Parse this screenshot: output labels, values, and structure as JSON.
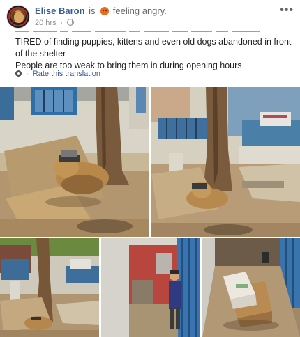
{
  "post": {
    "author": "Elise Baron",
    "is": "is",
    "feeling": "feeling angry.",
    "timestamp": "20 hrs",
    "separator": "·",
    "more": "•••",
    "text_line_1": "TIRED of finding puppies, kittens and even old dogs abandoned in front of the shelter",
    "text_line_2": "People are too weak to bring them in during opening hours",
    "rate_translation": "Rate this translation",
    "translate_sep": "·"
  },
  "icons": {
    "avatar": "dog-avatar",
    "feeling": "angry-face-icon",
    "privacy": "globe-icon",
    "more": "more-options-icon",
    "translation": "gear-icon"
  },
  "colors": {
    "link": "#385898",
    "meta": "#90949c",
    "text": "#1c1e21"
  }
}
